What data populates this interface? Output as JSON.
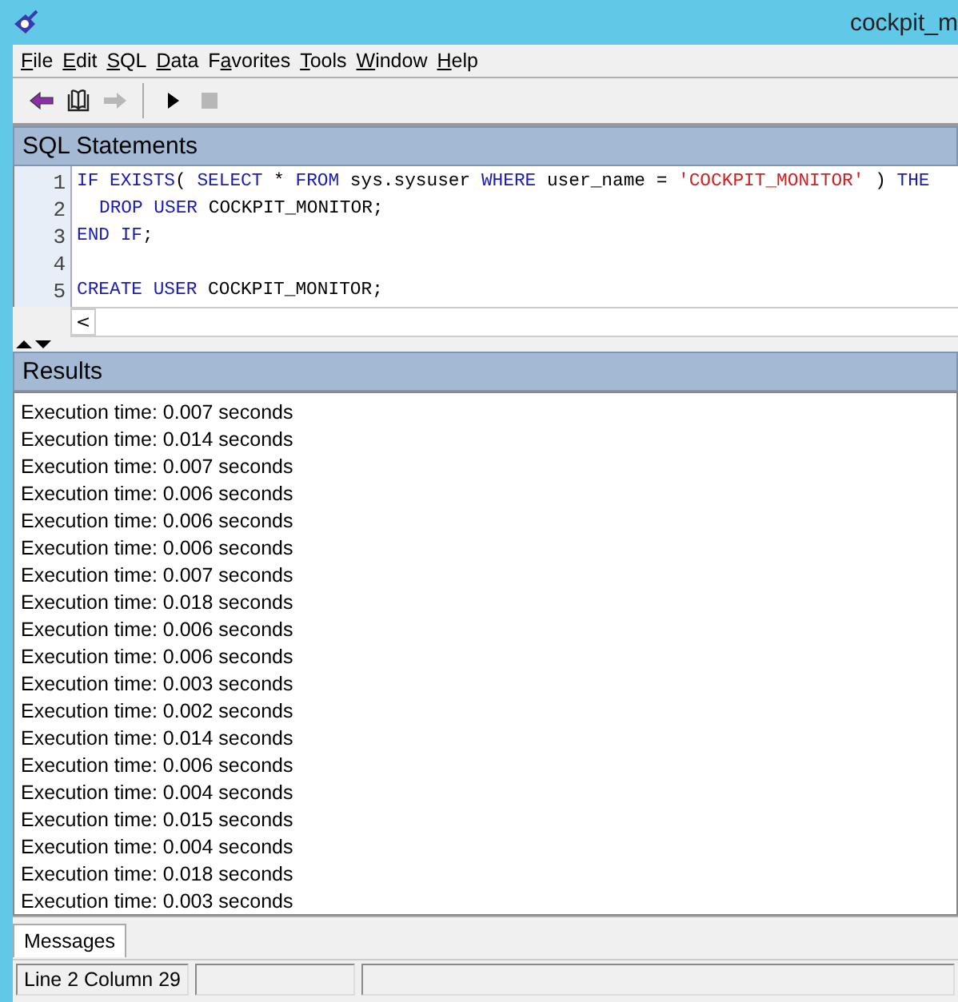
{
  "window": {
    "title": "cockpit_m"
  },
  "menu": [
    {
      "parts": [
        {
          "text": "F",
          "underline": true
        },
        {
          "text": "ile",
          "underline": false
        }
      ]
    },
    {
      "parts": [
        {
          "text": "E",
          "underline": true
        },
        {
          "text": "dit",
          "underline": false
        }
      ]
    },
    {
      "parts": [
        {
          "text": "S",
          "underline": true
        },
        {
          "text": "QL",
          "underline": false
        }
      ]
    },
    {
      "parts": [
        {
          "text": "D",
          "underline": true
        },
        {
          "text": "ata",
          "underline": false
        }
      ]
    },
    {
      "parts": [
        {
          "text": "F",
          "underline": false
        },
        {
          "text": "a",
          "underline": true
        },
        {
          "text": "vorites",
          "underline": false
        }
      ]
    },
    {
      "parts": [
        {
          "text": "T",
          "underline": true
        },
        {
          "text": "ools",
          "underline": false
        }
      ]
    },
    {
      "parts": [
        {
          "text": "W",
          "underline": true
        },
        {
          "text": "indow",
          "underline": false
        }
      ]
    },
    {
      "parts": [
        {
          "text": "H",
          "underline": true
        },
        {
          "text": "elp",
          "underline": false
        }
      ]
    }
  ],
  "toolbar": [
    {
      "kind": "back",
      "disabled": false
    },
    {
      "kind": "book",
      "disabled": false
    },
    {
      "kind": "forward",
      "disabled": true
    },
    {
      "kind": "separator"
    },
    {
      "kind": "play",
      "disabled": false
    },
    {
      "kind": "stop",
      "disabled": true
    }
  ],
  "sql_panel": {
    "title": "SQL Statements",
    "lines": [
      {
        "number": "1",
        "indent": false,
        "tokens": [
          {
            "kind": "keyword",
            "text": "IF EXISTS"
          },
          {
            "kind": "plain",
            "text": "( "
          },
          {
            "kind": "keyword",
            "text": "SELECT"
          },
          {
            "kind": "plain",
            "text": " * "
          },
          {
            "kind": "keyword",
            "text": "FROM"
          },
          {
            "kind": "plain",
            "text": " sys.sysuser "
          },
          {
            "kind": "keyword",
            "text": "WHERE"
          },
          {
            "kind": "plain",
            "text": " user_name = "
          },
          {
            "kind": "string",
            "text": "'COCKPIT_MONITOR'"
          },
          {
            "kind": "plain",
            "text": " ) "
          },
          {
            "kind": "keyword",
            "text": "THE"
          }
        ]
      },
      {
        "number": "2",
        "indent": true,
        "tokens": [
          {
            "kind": "keyword",
            "text": "DROP USER"
          },
          {
            "kind": "plain",
            "text": " COCKPIT_MONITOR;"
          }
        ]
      },
      {
        "number": "3",
        "indent": false,
        "tokens": [
          {
            "kind": "keyword",
            "text": "END IF"
          },
          {
            "kind": "plain",
            "text": ";"
          }
        ]
      },
      {
        "number": "4"
      },
      {
        "number": "5",
        "indent": false,
        "tokens": [
          {
            "kind": "keyword",
            "text": "CREATE USER"
          },
          {
            "kind": "plain",
            "text": " COCKPIT_MONITOR;"
          }
        ]
      }
    ],
    "scroll_left": "<"
  },
  "results_panel": {
    "title": "Results",
    "rows": [
      "Execution time: 0.007 seconds",
      "Execution time: 0.014 seconds",
      "Execution time: 0.007 seconds",
      "Execution time: 0.006 seconds",
      "Execution time: 0.006 seconds",
      "Execution time: 0.006 seconds",
      "Execution time: 0.007 seconds",
      "Execution time: 0.018 seconds",
      "Execution time: 0.006 seconds",
      "Execution time: 0.006 seconds",
      "Execution time: 0.003 seconds",
      "Execution time: 0.002 seconds",
      "Execution time: 0.014 seconds",
      "Execution time: 0.006 seconds",
      "Execution time: 0.004 seconds",
      "Execution time: 0.015 seconds",
      "Execution time: 0.004 seconds",
      "Execution time: 0.018 seconds",
      "Execution time: 0.003 seconds"
    ],
    "tabs": [
      {
        "label": "Messages",
        "selected": true
      }
    ]
  },
  "status_bar": {
    "position": "Line 2  Column 29"
  }
}
